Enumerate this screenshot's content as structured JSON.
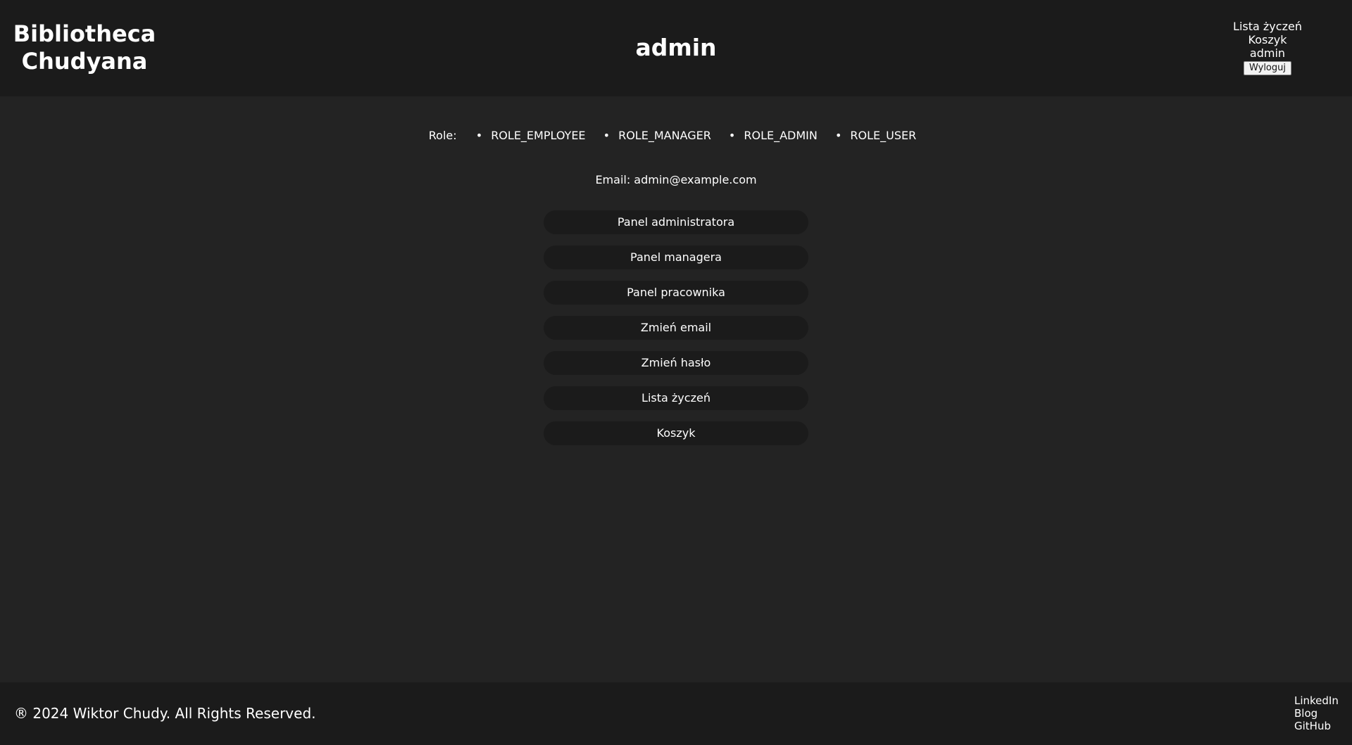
{
  "header": {
    "brand_line1": "Bibliotheca",
    "brand_line2": "Chudyana",
    "title": "admin",
    "nav": {
      "wishlist": "Lista życzeń",
      "cart": "Koszyk",
      "user": "admin",
      "logout": "Wyloguj"
    }
  },
  "profile": {
    "roles_label": "Role:",
    "roles": [
      "ROLE_EMPLOYEE",
      "ROLE_MANAGER",
      "ROLE_ADMIN",
      "ROLE_USER"
    ],
    "email_text": "Email: admin@example.com"
  },
  "actions": [
    "Panel administratora",
    "Panel managera",
    "Panel pracownika",
    "Zmień email",
    "Zmień hasło",
    "Lista życzeń",
    "Koszyk"
  ],
  "footer": {
    "copyright": "® 2024 Wiktor Chudy. All Rights Reserved.",
    "links": [
      "LinkedIn",
      "Blog",
      "GitHub"
    ]
  },
  "colors": {
    "background": "#232323",
    "bars": "#1b1b1b",
    "text": "#ffffff"
  }
}
